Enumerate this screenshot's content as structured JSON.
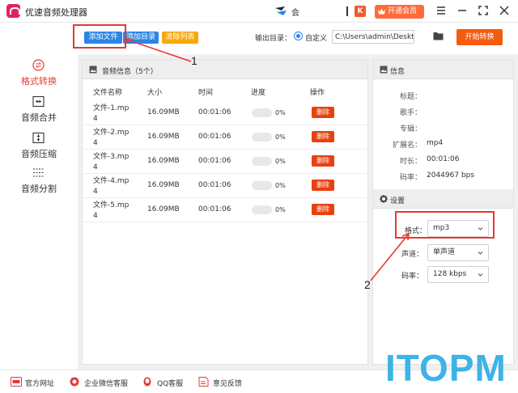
{
  "app": {
    "title": "优速音频处理器"
  },
  "header": {
    "user_name": "会",
    "vip_label": "开通会员",
    "k_badge": "K"
  },
  "sidebar": {
    "items": [
      {
        "label": "格式转换",
        "icon": "format-convert-icon",
        "active": true
      },
      {
        "label": "音频合并",
        "icon": "merge-icon",
        "active": false
      },
      {
        "label": "音频压缩",
        "icon": "compress-icon",
        "active": false
      },
      {
        "label": "音频分割",
        "icon": "split-icon",
        "active": false
      }
    ]
  },
  "toolbar": {
    "add_file": "添加文件",
    "add_dir": "添加目录",
    "clear_list": "清除列表",
    "output_label": "输出目录：",
    "custom_label": "自定义",
    "path_value": "C:\\Users\\admin\\Deskto",
    "start": "开始转换"
  },
  "file_list": {
    "panel_title": "音频信息（5个）",
    "columns": [
      "文件名称",
      "大小",
      "时间",
      "进度",
      "操作"
    ],
    "rows": [
      {
        "name": "文件-1.mp4",
        "size": "16.09MB",
        "time": "00:01:06",
        "progress": 0,
        "progress_text": "0%",
        "action": "删除"
      },
      {
        "name": "文件-2.mp4",
        "size": "16.09MB",
        "time": "00:01:06",
        "progress": 0,
        "progress_text": "0%",
        "action": "删除"
      },
      {
        "name": "文件-3.mp4",
        "size": "16.09MB",
        "time": "00:01:06",
        "progress": 0,
        "progress_text": "0%",
        "action": "删除"
      },
      {
        "name": "文件-4.mp4",
        "size": "16.09MB",
        "time": "00:01:06",
        "progress": 0,
        "progress_text": "0%",
        "action": "删除"
      },
      {
        "name": "文件-5.mp4",
        "size": "16.09MB",
        "time": "00:01:06",
        "progress": 0,
        "progress_text": "0%",
        "action": "删除"
      }
    ]
  },
  "info": {
    "title": "信息",
    "fields": [
      {
        "label": "标题：",
        "value": ""
      },
      {
        "label": "歌手：",
        "value": ""
      },
      {
        "label": "专辑：",
        "value": ""
      },
      {
        "label": "扩展名：",
        "value": "mp4"
      },
      {
        "label": "时长：",
        "value": "00:01:06"
      },
      {
        "label": "码率：",
        "value": "2044967 bps"
      }
    ]
  },
  "settings": {
    "title": "设置",
    "format_label": "格式：",
    "format_value": "mp3",
    "channel_label": "声道：",
    "channel_value": "单声道",
    "bitrate_label": "码率：",
    "bitrate_value": "128 kbps"
  },
  "footer": {
    "items": [
      {
        "label": "官方网址",
        "icon": "website-icon"
      },
      {
        "label": "企业微信客服",
        "icon": "wechat-service-icon"
      },
      {
        "label": "QQ客服",
        "icon": "qq-icon"
      },
      {
        "label": "意见反馈",
        "icon": "feedback-icon"
      }
    ]
  },
  "annotations": {
    "num1": "1",
    "num2": "2"
  },
  "watermark": "ITOPM",
  "colors": {
    "accent": "#2b86e5",
    "danger": "#e8410f",
    "start": "#f45b0f",
    "active": "#e53935",
    "clear": "#f7a80d"
  }
}
